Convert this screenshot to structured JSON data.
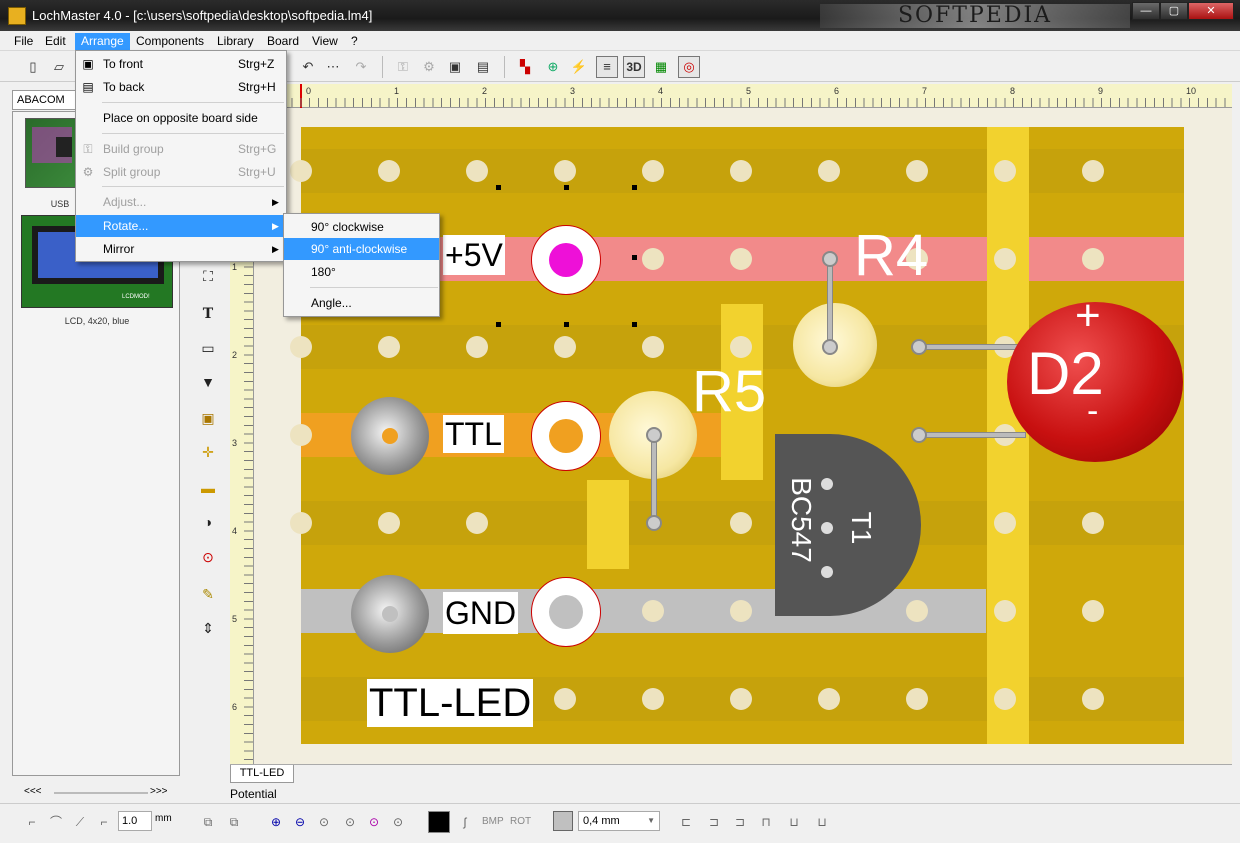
{
  "window": {
    "title": "LochMaster 4.0 - [c:\\users\\softpedia\\desktop\\softpedia.lm4]",
    "watermark": "SOFTPEDIA"
  },
  "menubar": [
    "File",
    "Edit",
    "Arrange",
    "Components",
    "Library",
    "Board",
    "View",
    "?"
  ],
  "arrange_menu": {
    "to_front": "To front",
    "to_front_sc": "Strg+Z",
    "to_back": "To back",
    "to_back_sc": "Strg+H",
    "opposite": "Place on opposite board side",
    "build_group": "Build group",
    "build_group_sc": "Strg+G",
    "split_group": "Split group",
    "split_group_sc": "Strg+U",
    "adjust": "Adjust...",
    "rotate": "Rotate...",
    "mirror": "Mirror"
  },
  "rotate_submenu": {
    "cw": "90° clockwise",
    "acw": "90° anti-clockwise",
    "r180": "180°",
    "angle": "Angle..."
  },
  "library": {
    "tab": "ABACOM",
    "item1": "USB",
    "item2": "LCD, 4x20, blue",
    "lcd_label": "LCDMOD!",
    "scroll_left": "<<<",
    "scroll_right": ">>>"
  },
  "ruler": {
    "top": [
      "0",
      "1",
      "2",
      "3",
      "4",
      "5",
      "6",
      "7",
      "8",
      "9",
      "10"
    ],
    "left": [
      "1",
      "2",
      "3",
      "4",
      "5",
      "6"
    ]
  },
  "board_labels": {
    "vplus": "+5V",
    "ttl": "TTL",
    "gnd": "GND",
    "title": "TTL-LED",
    "r4": "R4",
    "r5": "R5",
    "d2": "D2",
    "d2_plus": "+",
    "d2_minus": "-",
    "bc547": "BC547",
    "t1": "T1"
  },
  "tabs": {
    "sheet": "TTL-LED"
  },
  "status": {
    "text": "Potential"
  },
  "bottombar": {
    "width_value": "1.0",
    "width_unit": "mm",
    "bmp": "BMP",
    "rot": "ROT",
    "line_width": "0,4 mm"
  },
  "colors": {
    "menu_highlight": "#3399ff",
    "board": "#cfa80a",
    "strip_pink": "#f28a8a",
    "strip_orange": "#f0a020",
    "strip_gray": "#c0c0c0",
    "led_d2": "#c81010",
    "transistor": "#555555"
  }
}
